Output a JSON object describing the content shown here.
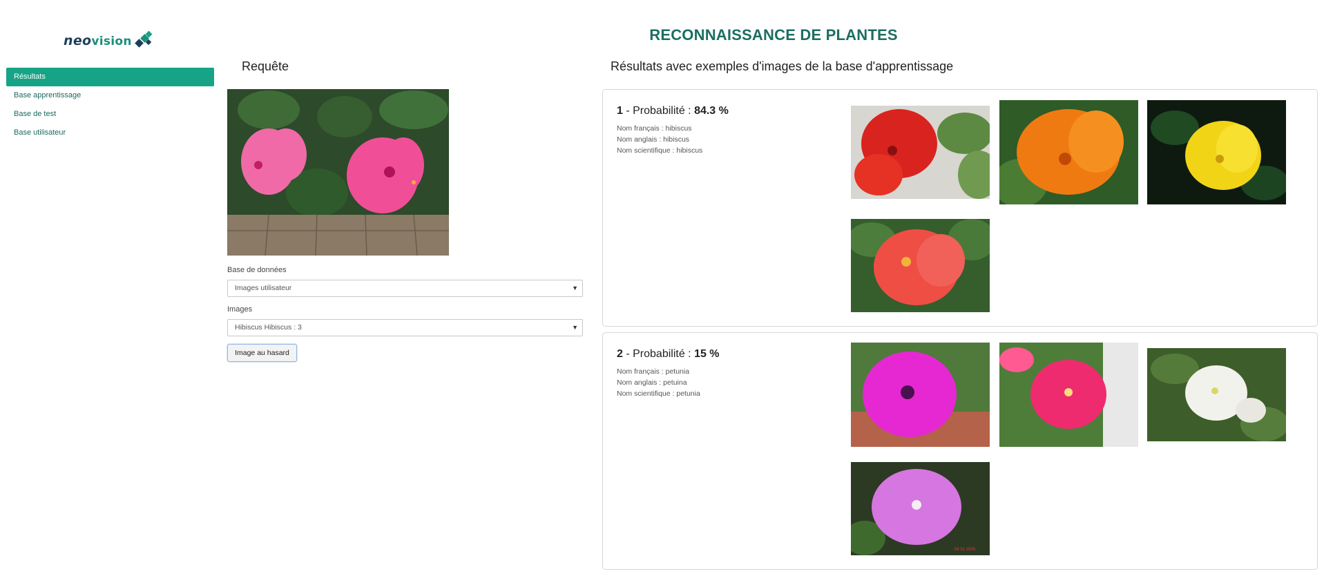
{
  "brand": {
    "neo": "neo",
    "vision": "vision",
    "colors": {
      "dark": "#1e3f5a",
      "teal": "#1a8f7b"
    }
  },
  "sidebar": {
    "items": [
      {
        "label": "Résultats",
        "active": true
      },
      {
        "label": "Base apprentissage",
        "active": false
      },
      {
        "label": "Base de test",
        "active": false
      },
      {
        "label": "Base utilisateur",
        "active": false
      }
    ]
  },
  "page_title": "RECONNAISSANCE DE PLANTES",
  "query": {
    "heading": "Requête",
    "image_icon": "hibiscus-photo",
    "database_label": "Base de données",
    "database_value": "Images utilisateur",
    "images_label": "Images",
    "images_value": "Hibiscus Hibiscus : 3",
    "random_button": "Image au hasard"
  },
  "results": {
    "heading": "Résultats avec exemples d'images de la base d'apprentissage",
    "items": [
      {
        "rank": "1",
        "sep": " - Probabilité : ",
        "probability": "84.3 %",
        "french": "Nom français : hibiscus",
        "english": "Nom anglais : hibiscus",
        "scientific": "Nom scientifique : hibiscus",
        "images": [
          "red-hibiscus-photo",
          "orange-hibiscus-photo",
          "yellow-hibiscus-photo",
          "coral-hibiscus-photo"
        ]
      },
      {
        "rank": "2",
        "sep": " - Probabilité : ",
        "probability": "15 %",
        "french": "Nom français : petunia",
        "english": "Nom anglais : petuina",
        "scientific": "Nom scientifique : petunia",
        "images": [
          "magenta-petunia-photo",
          "pink-petunia-photo",
          "white-petunia-photo",
          "lilac-petunia-photo"
        ]
      }
    ]
  },
  "colors": {
    "accent": "#17a386",
    "title": "#1c6e62"
  }
}
